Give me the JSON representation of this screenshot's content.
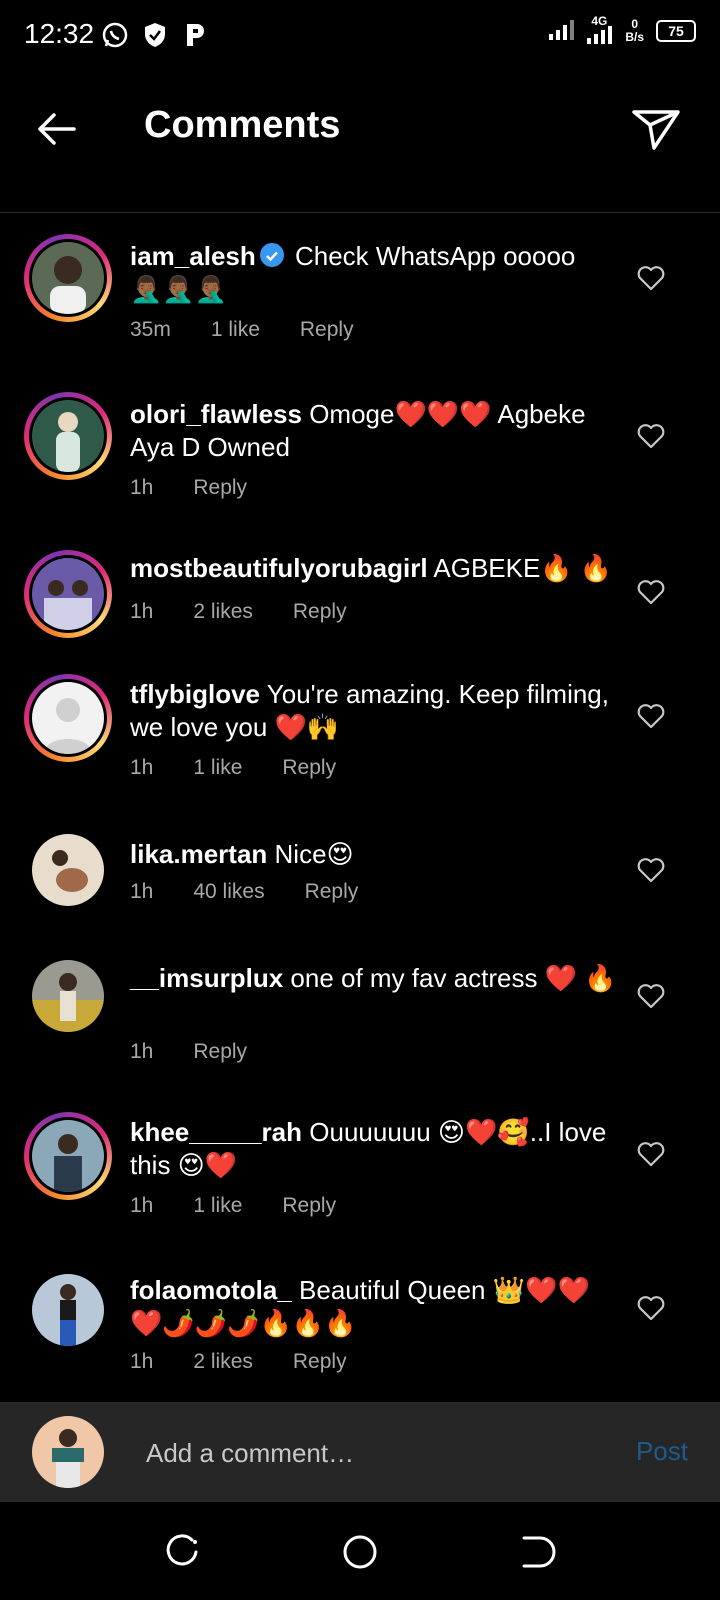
{
  "status": {
    "time": "12:32",
    "network": "4G",
    "speed_value": "0",
    "speed_unit": "B/s",
    "battery": "75"
  },
  "header": {
    "title": "Comments"
  },
  "comments": [
    {
      "username": "iam_alesh",
      "verified": true,
      "text": "Check WhatsApp ooooo",
      "emoji": "🤦🏾‍♂️🤦🏾‍♂️🤦🏾‍♂️",
      "time": "35m",
      "likes": "1 like",
      "reply": "Reply",
      "ring": true
    },
    {
      "username": "olori_flawless",
      "text": "Omoge❤️❤️❤️ Agbeke Aya D Owned",
      "time": "1h",
      "likes": "",
      "reply": "Reply",
      "ring": true
    },
    {
      "username": "mostbeautifulyorubagirl",
      "text": "AGBEKE🔥 🔥",
      "time": "1h",
      "likes": "2 likes",
      "reply": "Reply",
      "ring": true
    },
    {
      "username": "tflybiglove",
      "text": "You're amazing. Keep filming, we love you ❤️🙌",
      "time": "1h",
      "likes": "1 like",
      "reply": "Reply",
      "ring": true
    },
    {
      "username": "lika.mertan",
      "text": "Nice😍",
      "time": "1h",
      "likes": "40 likes",
      "reply": "Reply",
      "ring": false
    },
    {
      "username": "__imsurplux",
      "text": "one of my fav actress ❤️ 🔥",
      "time": "1h",
      "likes": "",
      "reply": "Reply",
      "ring": false
    },
    {
      "username": "khee_____rah",
      "text": "Ouuuuuuu 😍❤️🥰..I love this 😍❤️",
      "time": "1h",
      "likes": "1 like",
      "reply": "Reply",
      "ring": true
    },
    {
      "username": "folaomotola_",
      "text": "Beautiful Queen 👑❤️❤️ ❤️🌶️🌶️🌶️🔥🔥🔥",
      "time": "1h",
      "likes": "2 likes",
      "reply": "Reply",
      "ring": false
    }
  ],
  "composer": {
    "placeholder": "Add a comment…",
    "post_label": "Post"
  },
  "colors": {
    "background": "#000000",
    "meta_text": "#a8a8a8",
    "verified": "#3897f0",
    "post_disabled": "#1e5a8a",
    "composer_bg": "#262626"
  }
}
